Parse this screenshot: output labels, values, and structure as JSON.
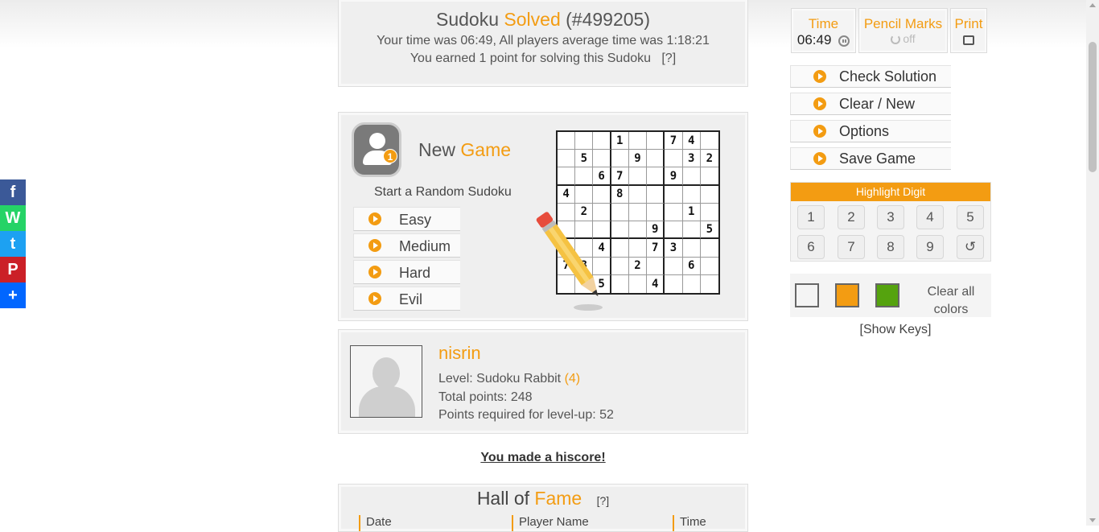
{
  "solved": {
    "title_prefix": "Sudoku",
    "title_highlight": "Solved",
    "title_id": "(#499205)",
    "time_line": "Your time was 06:49, All players average time was 1:18:21",
    "points_line": "You earned 1 point for solving this Sudoku",
    "help": "[?]"
  },
  "new_game": {
    "title_prefix": "New",
    "title_highlight": "Game",
    "badge_number": "1",
    "start_random": "Start a Random Sudoku",
    "difficulties": [
      "Easy",
      "Medium",
      "Hard",
      "Evil"
    ],
    "preview_grid": [
      "",
      "",
      "",
      "1",
      "",
      "",
      "7",
      "4",
      "",
      "",
      "5",
      "",
      "",
      "9",
      "",
      "",
      "3",
      "2",
      "",
      "",
      "6",
      "7",
      "",
      "",
      "9",
      "",
      "",
      "4",
      "",
      "",
      "8",
      "",
      "",
      "",
      "",
      "",
      "",
      "2",
      "",
      "",
      "",
      "",
      "",
      "1",
      "",
      "",
      "",
      "",
      "",
      "",
      "9",
      "",
      "",
      "5",
      "",
      "",
      "4",
      "",
      "",
      "7",
      "3",
      "",
      "",
      "7",
      "3",
      "",
      "",
      "2",
      "",
      "",
      "6",
      "",
      "",
      "",
      "5",
      "",
      "",
      "4",
      "",
      "",
      ""
    ]
  },
  "profile": {
    "username": "nisrin",
    "level_label": "Level: Sudoku Rabbit",
    "level_value": "(4)",
    "total_points": "Total points: 248",
    "points_required": "Points required for level-up: 52"
  },
  "hiscore": "You made a hiscore!",
  "hall_of_fame": {
    "title_prefix": "Hall of",
    "title_highlight": "Fame",
    "help": "[?]",
    "columns": [
      "Date",
      "Player Name",
      "Time"
    ]
  },
  "controls": {
    "time_label": "Time",
    "time_value": "06:49",
    "pencil_label": "Pencil Marks",
    "pencil_state": "off",
    "print_label": "Print",
    "actions": [
      "Check Solution",
      "Clear / New",
      "Options",
      "Save Game"
    ]
  },
  "highlight": {
    "header": "Highlight Digit",
    "digits": [
      "1",
      "2",
      "3",
      "4",
      "5",
      "6",
      "7",
      "8",
      "9"
    ],
    "undo": "↺"
  },
  "colors": {
    "swatches": [
      "#f4f4f4",
      "#f39c12",
      "#55a30e"
    ],
    "clear_label": "Clear all colors"
  },
  "show_keys": "[Show Keys]",
  "social": [
    "f",
    "W",
    "t",
    "P",
    "+"
  ],
  "accent_color": "#f39c12"
}
